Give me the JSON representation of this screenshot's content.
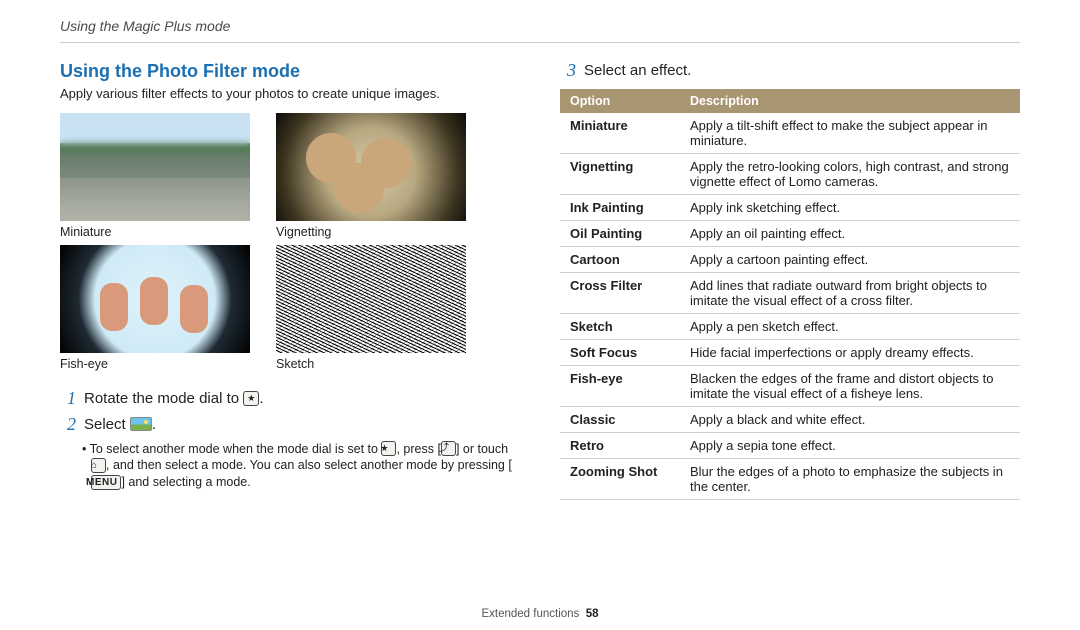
{
  "breadcrumb": "Using the Magic Plus mode",
  "section_title": "Using the Photo Filter mode",
  "intro": "Apply various filter effects to your photos to create unique images.",
  "thumbs": [
    {
      "label": "Miniature"
    },
    {
      "label": "Vignetting"
    },
    {
      "label": "Fish-eye"
    },
    {
      "label": "Sketch"
    }
  ],
  "steps": {
    "s1": "Rotate the mode dial to ",
    "s1_end": ".",
    "s2": "Select ",
    "s2_end": ".",
    "s3": "Select an effect."
  },
  "note": {
    "part1": "To select another mode when the mode dial is set to ",
    "part2": ", press [",
    "part3": "] or touch ",
    "part4": ", and then select a mode. You can also select another mode by pressing [",
    "menu": "MENU",
    "part5": "] and selecting a mode."
  },
  "table": {
    "h1": "Option",
    "h2": "Description",
    "rows": [
      {
        "opt": "Miniature",
        "desc": "Apply a tilt-shift effect to make the subject appear in miniature."
      },
      {
        "opt": "Vignetting",
        "desc": "Apply the retro-looking colors, high contrast, and strong vignette effect of Lomo cameras."
      },
      {
        "opt": "Ink Painting",
        "desc": "Apply ink sketching effect."
      },
      {
        "opt": "Oil Painting",
        "desc": "Apply an oil painting effect."
      },
      {
        "opt": "Cartoon",
        "desc": "Apply a cartoon painting effect."
      },
      {
        "opt": "Cross Filter",
        "desc": "Add lines that radiate outward from bright objects to imitate the visual effect of a cross filter."
      },
      {
        "opt": "Sketch",
        "desc": "Apply a pen sketch effect."
      },
      {
        "opt": "Soft Focus",
        "desc": "Hide facial imperfections or apply dreamy effects."
      },
      {
        "opt": "Fish-eye",
        "desc": "Blacken the edges of the frame and distort objects to imitate the visual effect of a fisheye lens."
      },
      {
        "opt": "Classic",
        "desc": "Apply a black and white effect."
      },
      {
        "opt": "Retro",
        "desc": "Apply a sepia tone effect."
      },
      {
        "opt": "Zooming Shot",
        "desc": "Blur the edges of a photo to emphasize the subjects in the center."
      }
    ]
  },
  "footer": {
    "section": "Extended functions",
    "page": "58"
  }
}
